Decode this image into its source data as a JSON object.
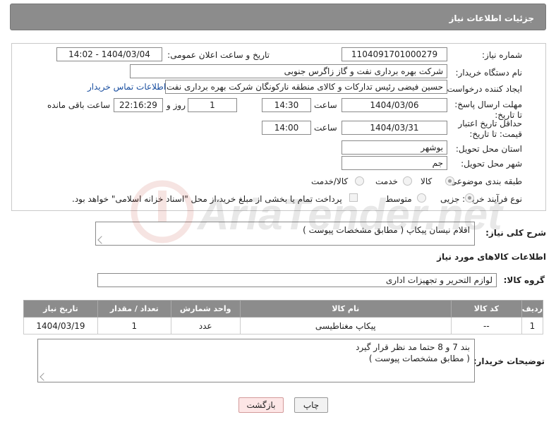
{
  "header": {
    "title": "جزئیات اطلاعات نیاز"
  },
  "form": {
    "need_number_label": "شماره نیاز:",
    "need_number": "1104091701000279",
    "announce_label": "تاریخ و ساعت اعلان عمومی:",
    "announce_value": "1404/03/04 - 14:02",
    "buyer_label": "نام دستگاه خریدار:",
    "buyer_value": "شرکت بهره برداری نفت و گاز زاگرس جنوبی",
    "creator_label": "ایجاد کننده درخواست:",
    "creator_value": "حسین فیضی رئیس تدارکات و کالای منطقه نارکونگان شرکت بهره برداری نفت و",
    "contact_link": "اطلاعات تماس خریدار",
    "deadline_label": "مهلت ارسال پاسخ: تا تاریخ:",
    "deadline_date": "1404/03/06",
    "time_label": "ساعت",
    "deadline_time": "14:30",
    "days_value": "1",
    "days_label": "روز و",
    "remaining_time": "22:16:29",
    "remaining_label": "ساعت باقی مانده",
    "min_price_label": "حداقل تاریخ اعتبار قیمت: تا تاریخ:",
    "min_price_date": "1404/03/31",
    "min_price_time": "14:00",
    "province_label": "استان محل تحویل:",
    "province_value": "بوشهر",
    "city_label": "شهر محل تحویل:",
    "city_value": "جم",
    "category_label": "طبقه بندی موضوعی:",
    "category_options": [
      "کالا",
      "خدمت",
      "کالا/خدمت"
    ],
    "category_selected": "کالا",
    "process_label": "نوع فرآیند خرید :",
    "process_options": [
      "جزیی",
      "متوسط"
    ],
    "process_selected": "جزیی",
    "payment_note": "پرداخت تمام یا بخشی از مبلغ خرید،از محل \"اسناد خزانه اسلامی\" خواهد بود."
  },
  "description": {
    "label": "شرح کلی نیاز:",
    "value": "اقلام نیسان پیکاپ ( مطابق مشخصات پیوست )"
  },
  "goods": {
    "section_title": "اطلاعات کالاهای مورد نیاز",
    "group_label": "گروه کالا:",
    "group_value": "لوازم التحریر و تجهیزات اداری",
    "columns": [
      "ردیف",
      "کد کالا",
      "نام کالا",
      "واحد شمارش",
      "تعداد / مقدار",
      "تاریخ نیاز"
    ],
    "rows": [
      {
        "index": "1",
        "code": "--",
        "name": "پیکاپ مغناطیسی",
        "unit": "عدد",
        "qty": "1",
        "date": "1404/03/19"
      }
    ]
  },
  "buyer_notes": {
    "label": "توضیحات خریدار:",
    "line1": "بند  7   و 8  حتما مد نظر قرار گیرد",
    "line2": "( مطابق مشخصات پیوست )"
  },
  "buttons": {
    "print": "چاپ",
    "back": "بازگشت"
  },
  "watermark": "AriaTender.net"
}
